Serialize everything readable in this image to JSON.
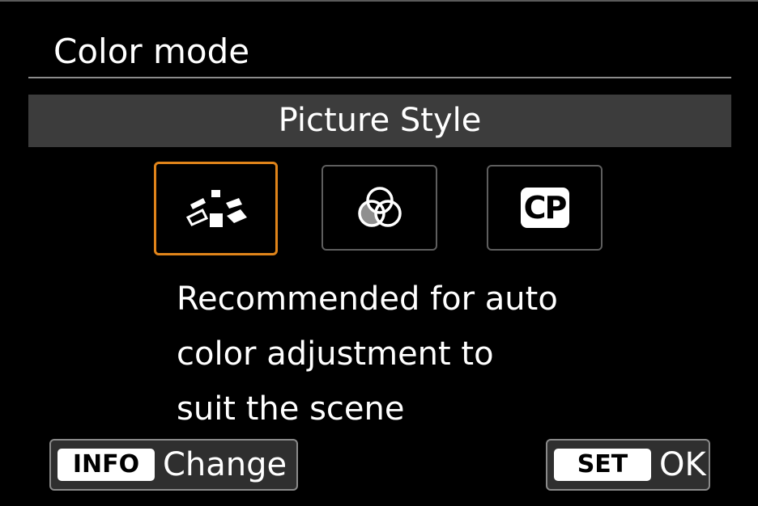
{
  "screen": {
    "title": "Color mode",
    "section_label": "Picture Style",
    "selection_color": "#e0841a"
  },
  "options": [
    {
      "icon": "auto-picture-style-icon",
      "selected": true
    },
    {
      "icon": "overlapping-circles-icon",
      "selected": false
    },
    {
      "icon": "cp-icon",
      "label": "CP",
      "selected": false
    }
  ],
  "description": {
    "lines": [
      "Recommended for auto",
      "color adjustment to",
      "suit the scene"
    ]
  },
  "footer": {
    "info_key": "INFO",
    "info_label": "Change",
    "set_key": "SET",
    "set_label": "OK"
  }
}
